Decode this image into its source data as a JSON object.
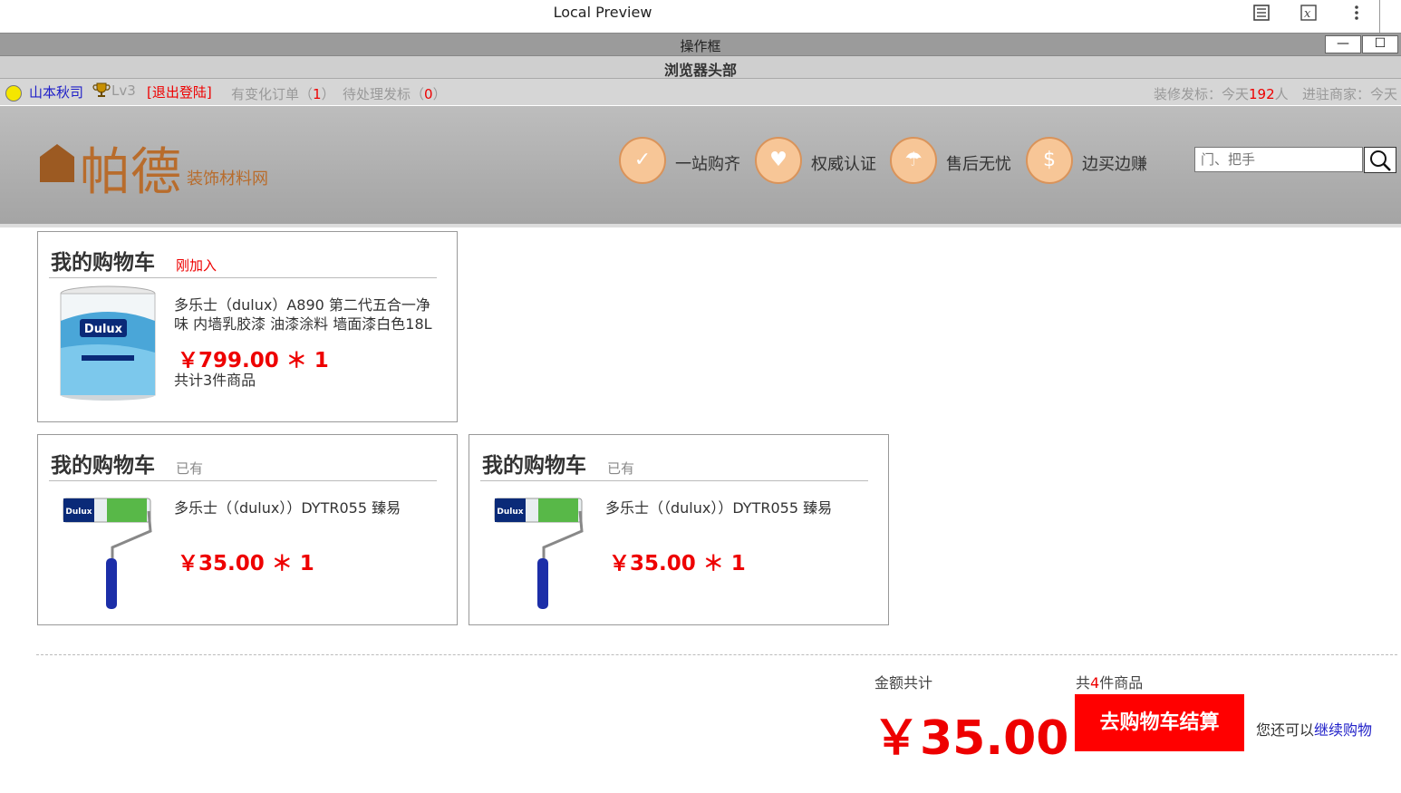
{
  "window": {
    "title": "Local Preview",
    "toolbar_icons": [
      "reader-icon",
      "formula-icon",
      "more-icon"
    ],
    "operation_frame": "操作框",
    "minimize": "—",
    "maximize": "☐",
    "browser_head": "浏览器头部"
  },
  "userbar": {
    "username": "山本秋司",
    "level": "Lv3",
    "logout": "[退出登陆]",
    "changed_orders_label": "有变化订单（",
    "changed_orders_count": "1",
    "changed_orders_close": "）",
    "pending_bids_label": "待处理发标（",
    "pending_bids_count": "0",
    "pending_bids_close": "）",
    "renovation_label": "装修发标：今天",
    "renovation_count": "192",
    "renovation_unit": "人",
    "merchants_label": "进驻商家：今天"
  },
  "header": {
    "logo_main": "帕德",
    "logo_sub": "装饰材料网",
    "features": [
      {
        "icon": "check-icon",
        "glyph": "✓",
        "label": "一站购齐"
      },
      {
        "icon": "heart-icon",
        "glyph": "♥",
        "label": "权威认证"
      },
      {
        "icon": "umbrella-icon",
        "glyph": "☂",
        "label": "售后无忧"
      },
      {
        "icon": "dollar-icon",
        "glyph": "$",
        "label": "边买边赚"
      }
    ],
    "search_placeholder": "门、把手"
  },
  "cart_cards": [
    {
      "title": "我的购物车",
      "tag": "刚加入",
      "name": "多乐士（dulux）A890 第二代五合一净味 内墙乳胶漆 油漆涂料 墙面漆白色18L",
      "price": "￥799.00 ＊ 1",
      "count": "共计3件商品",
      "image": "paint-bucket"
    },
    {
      "title": "我的购物车",
      "tag": "已有",
      "name": "多乐士（（dulux））DYTR055 臻易",
      "price": "￥35.00 ＊ 1",
      "image": "paint-roller"
    },
    {
      "title": "我的购物车",
      "tag": "已有",
      "name": "多乐士（（dulux））DYTR055 臻易",
      "price": "￥35.00 ＊ 1",
      "image": "paint-roller"
    }
  ],
  "summary": {
    "total_label": "金额共计",
    "total": "￥35.00",
    "items_prefix": "共",
    "items_count": "4",
    "items_suffix": "件商品",
    "checkout": "去购物车结算",
    "continue_prefix": "您还可以",
    "continue_link": "继续购物"
  },
  "colors": {
    "price_red": "#ee0000",
    "brand_brown": "#b86c2c",
    "feature_orange": "#f7c697",
    "link_blue": "#2020c8"
  }
}
